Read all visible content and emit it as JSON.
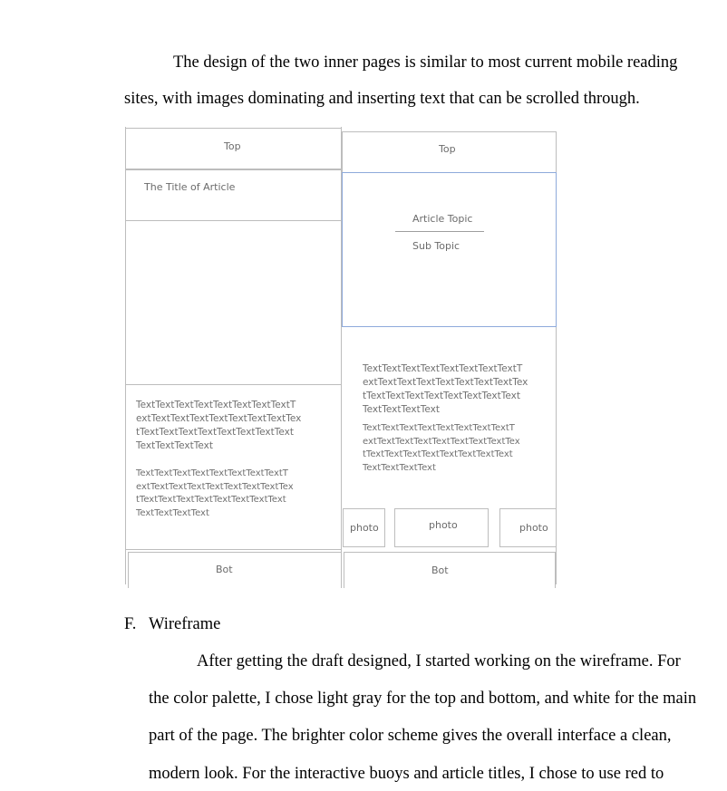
{
  "intro_paragraph": {
    "line1": "The design of the two inner pages is similar to most current mobile reading",
    "line2": "sites, with images dominating and inserting text that can be scrolled through."
  },
  "wireframe_left": {
    "top": "Top",
    "title": "The Title of Article",
    "text_block_1": [
      "TextTextTextTextTextTextTextTextT",
      "extTextTextTextTextTextTextTextTex",
      "tTextTextTextTextTextTextTextText",
      "TextTextTextText"
    ],
    "text_block_2": [
      "TextTextTextTextTextTextTextTextT",
      "extTextTextTextTextTextTextTextTex",
      "tTextTextTextTextTextTextTextText",
      "TextTextTextText"
    ],
    "bot": "Bot"
  },
  "wireframe_right": {
    "top": "Top",
    "article_topic": "Article Topic",
    "sub_topic": "Sub Topic",
    "text_block_1": [
      "TextTextTextTextTextTextTextTextT",
      "extTextTextTextTextTextTextTextTex",
      "tTextTextTextTextTextTextTextText",
      "TextTextTextText"
    ],
    "text_block_2": [
      "TextTextTextTextTextTextTextTextT",
      "extTextTextTextTextTextTextTextTex",
      "tTextTextTextTextTextTextTextText",
      "TextTextTextText"
    ],
    "photo_1": "photo",
    "photo_2": "photo",
    "photo_3": "photo",
    "bot": "Bot"
  },
  "section_heading": {
    "marker": "F.",
    "title": "Wireframe"
  },
  "wireframe_paragraph": {
    "line1": "After getting the draft designed, I started working on the wireframe. For",
    "line2": "the color palette, I chose light gray for the top and bottom, and white for the main",
    "line3": "part of the page. The brighter color scheme gives the overall interface a clean,",
    "line4": "modern look. For the interactive buoys and article titles, I chose to use red to"
  }
}
